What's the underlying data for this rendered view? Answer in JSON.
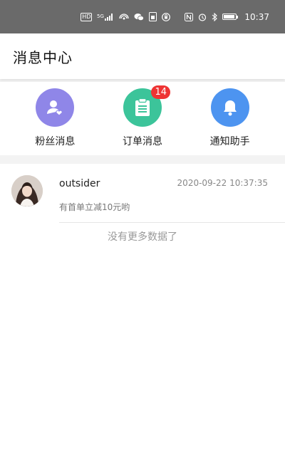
{
  "status_bar": {
    "time": "10:37",
    "left_icons": [
      "hd-icon",
      "signal-5g-icon",
      "hotspot-icon",
      "wechat-icon",
      "sim-icon",
      "vpn-icon"
    ],
    "right_icons": [
      "nfc-icon",
      "alarm-icon",
      "bluetooth-icon",
      "battery-icon"
    ],
    "hd_label": "HD",
    "net_label": "5G"
  },
  "header": {
    "title": "消息中心"
  },
  "categories": [
    {
      "label": "粉丝消息",
      "icon": "user-heart-icon",
      "color": "#8f86e8"
    },
    {
      "label": "订单消息",
      "icon": "clipboard-icon",
      "color": "#3cc49a",
      "badge": "14"
    },
    {
      "label": "通知助手",
      "icon": "bell-icon",
      "color": "#4d94f0"
    }
  ],
  "messages": [
    {
      "name": "outsider",
      "time": "2020-09-22 10:37:35",
      "preview": "有首单立减10元哟"
    }
  ],
  "footer": {
    "no_more_text": "没有更多数据了"
  },
  "colors": {
    "status_bar": "#6a6a6a",
    "badge": "#e33333",
    "background": "#f3f3f3"
  }
}
